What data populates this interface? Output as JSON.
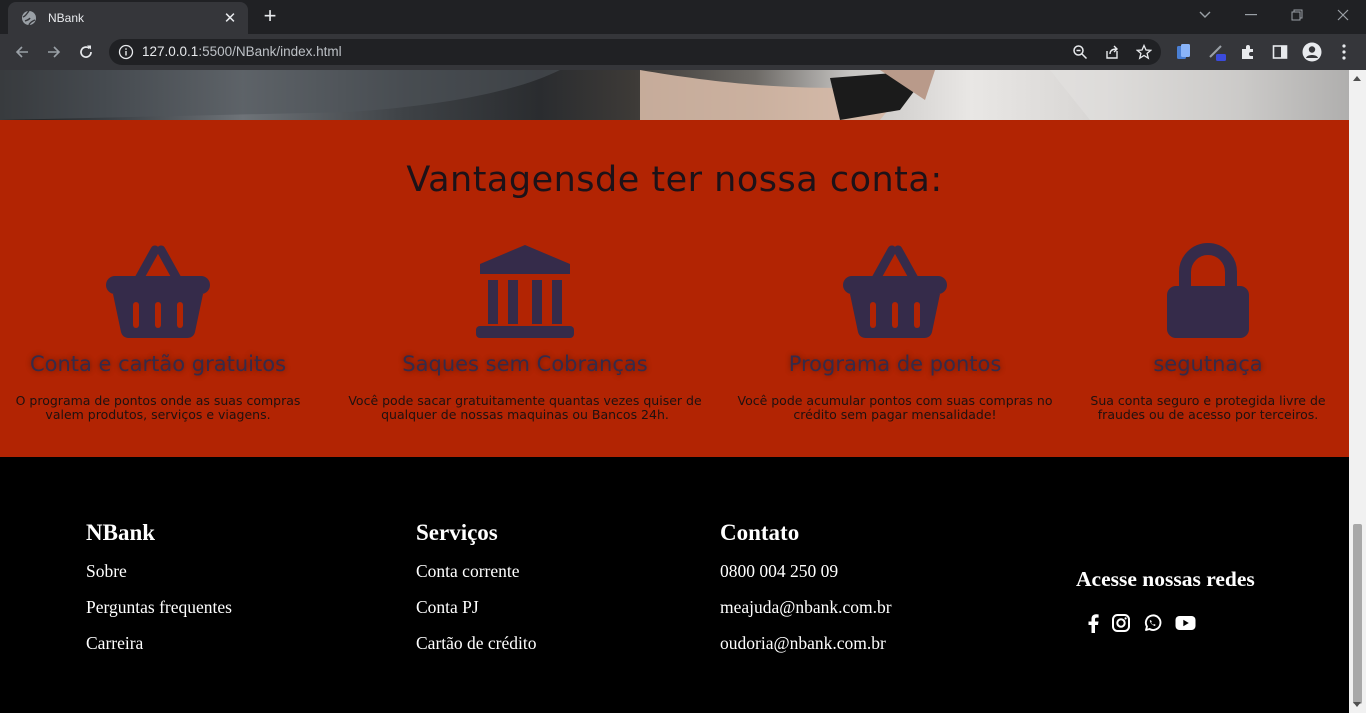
{
  "browser": {
    "tab_title": "NBank",
    "url_host": "127.0.0.1",
    "url_rest": ":5500/NBank/index.html"
  },
  "advantages": {
    "heading": "Vantagensde ter nossa conta:",
    "items": [
      {
        "icon": "basket-icon",
        "title": "Conta e cartão gratuitos",
        "text": "O programa de pontos onde as suas compras valem produtos, serviços e viagens."
      },
      {
        "icon": "bank-icon",
        "title": "Saques sem Cobranças",
        "text": "Você pode sacar gratuitamente quantas vezes quiser de qualquer de nossas maquinas ou Bancos 24h."
      },
      {
        "icon": "basket-icon",
        "title": "Programa de pontos",
        "text": "Você pode acumular pontos com suas compras no crédito sem pagar mensalidade!"
      },
      {
        "icon": "lock-icon",
        "title": "segutnaça",
        "text": "Sua conta seguro e protegida livre de fraudes ou de acesso por terceiros."
      }
    ],
    "colors": {
      "background": "#b22403",
      "icon": "#352b4a"
    }
  },
  "footer": {
    "col1": {
      "title": "NBank",
      "links": [
        "Sobre",
        "Perguntas frequentes",
        "Carreira"
      ]
    },
    "col2": {
      "title": "Serviços",
      "links": [
        "Conta corrente",
        "Conta PJ",
        "Cartão de crédito"
      ]
    },
    "col3": {
      "title": "Contato",
      "links": [
        "0800 004 250 09",
        "meajuda@nbank.com.br",
        "oudoria@nbank.com.br"
      ]
    },
    "social": {
      "title": "Acesse nossas redes",
      "icons": [
        "facebook-icon",
        "instagram-icon",
        "whatsapp-icon",
        "youtube-icon"
      ]
    }
  }
}
